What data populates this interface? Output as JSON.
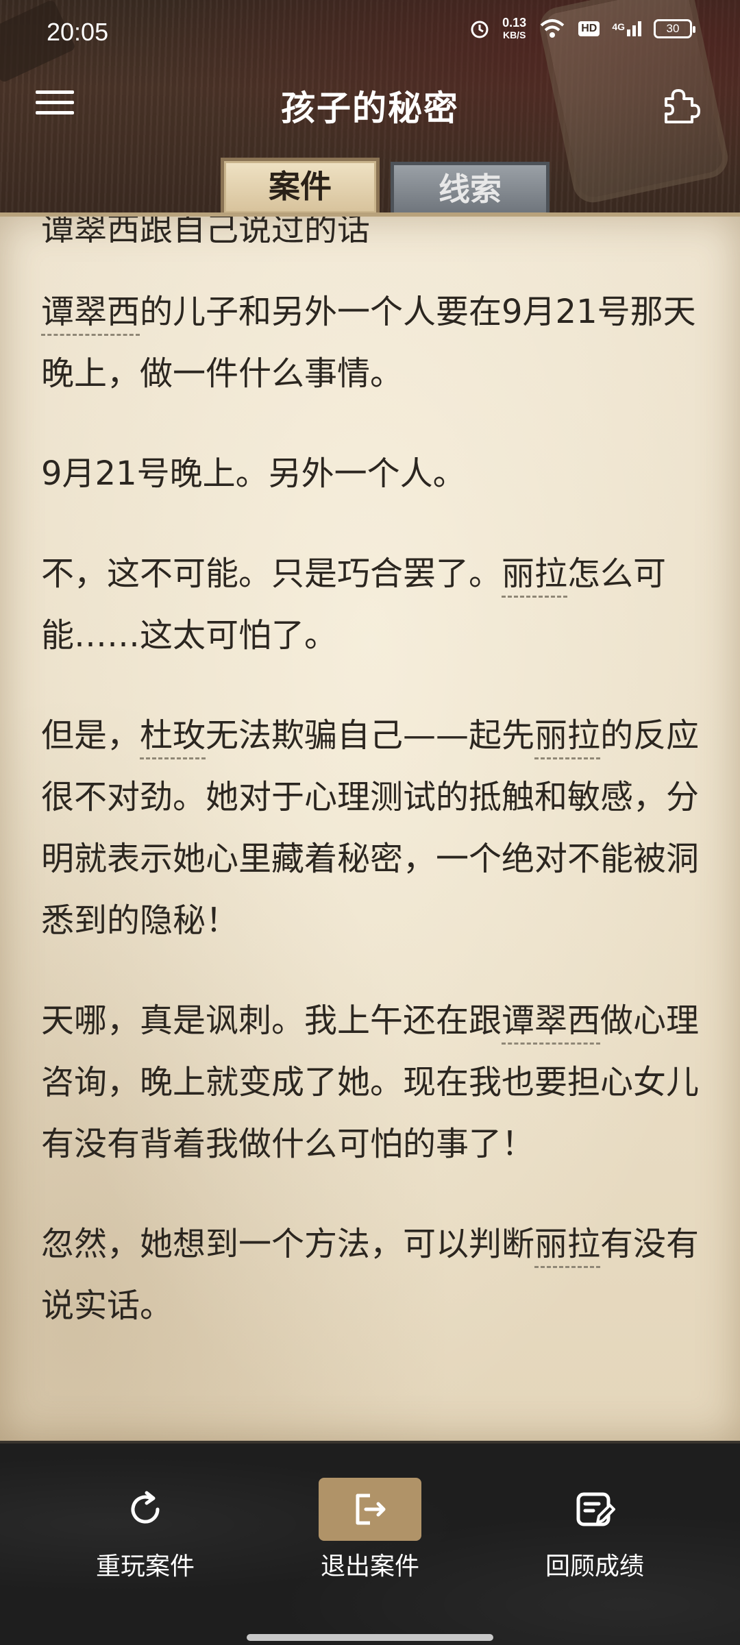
{
  "status_bar": {
    "time": "20:05",
    "net_speed_value": "0.13",
    "net_speed_unit": "KB/S",
    "hd": "HD",
    "signal": "4G",
    "battery": "30"
  },
  "header": {
    "title": "孩子的秘密"
  },
  "tabs": [
    {
      "label": "案件",
      "active": true
    },
    {
      "label": "线索",
      "active": false
    }
  ],
  "story": {
    "cut_line": {
      "kw": "谭翠西",
      "rest": "跟自己说过的话"
    },
    "p1": {
      "kw": "谭翠西",
      "rest": "的儿子和另外一个人要在9月21号那天晚上，做一件什么事情。"
    },
    "p2": "9月21号晚上。另外一个人。",
    "p3": {
      "a": "不，这不可能。只是巧合罢了。",
      "kw": "丽拉",
      "b": "怎么可能……这太可怕了。"
    },
    "p4": {
      "a": "但是，",
      "kw1": "杜玫",
      "b": "无法欺骗自己——起先",
      "kw2": "丽拉",
      "c": "的反应很不对劲。她对于心理测试的抵触和敏感，分明就表示她心里藏着秘密，一个绝对不能被洞悉到的隐秘！"
    },
    "p5": {
      "a": "天哪，真是讽刺。我上午还在跟",
      "kw": "谭翠西",
      "b": "做心理咨询，晚上就变成了她。现在我也要担心女儿有没有背着我做什么可怕的事了！"
    },
    "p6": {
      "a": "忽然，她想到一个方法，可以判断",
      "kw": "丽拉",
      "b": "有没有说实话。"
    }
  },
  "bottom_bar": {
    "replay": "重玩案件",
    "exit": "退出案件",
    "review": "回顾成绩"
  },
  "colors": {
    "accent": "#b09368",
    "paper": "#ebe0c9",
    "text": "#2b2620"
  }
}
